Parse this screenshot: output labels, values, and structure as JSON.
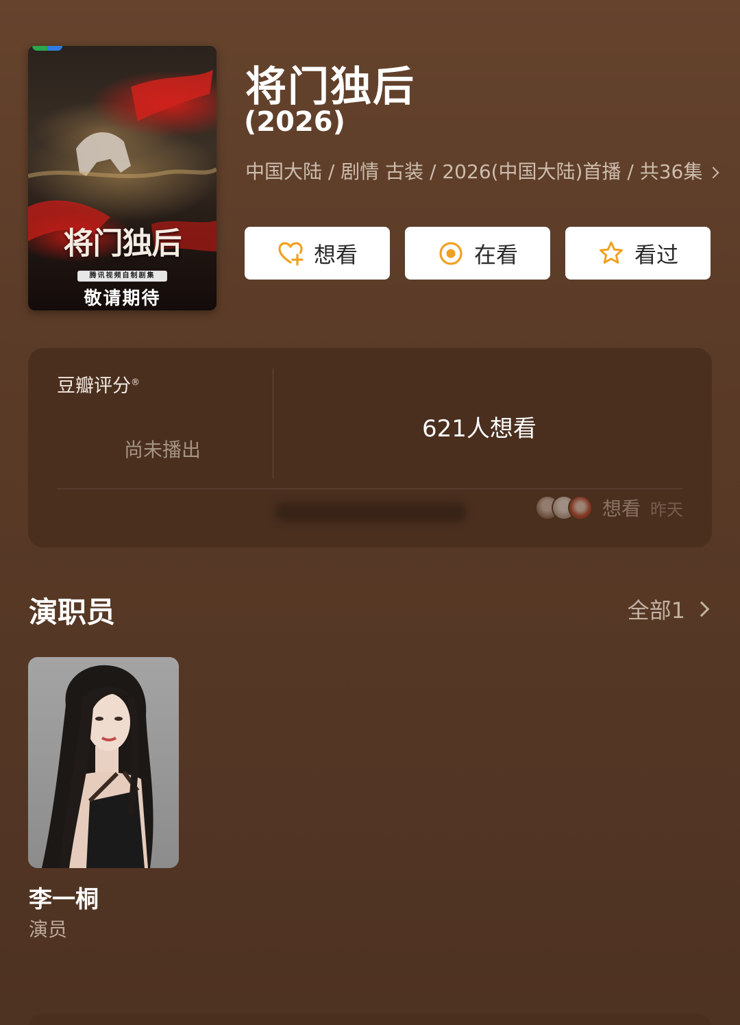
{
  "poster": {
    "title": "将门独后",
    "tag": "腾讯视频自制剧集",
    "subtitle": "敬请期待"
  },
  "show": {
    "title": "将门独后",
    "year": "(2026)",
    "meta": "中国大陆 / 剧情 古装 / 2026(中国大陆)首播 / 共36集"
  },
  "actions": [
    {
      "label": "想看",
      "icon": "heart-plus-icon"
    },
    {
      "label": "在看",
      "icon": "target-circle-icon"
    },
    {
      "label": "看过",
      "icon": "star-outline-icon"
    }
  ],
  "rating": {
    "label": "豆瓣评分",
    "mark": "®",
    "status": "尚未播出",
    "want_count": "621人想看",
    "activity_text": "想看",
    "activity_time": "昨天"
  },
  "cast": {
    "heading": "演职员",
    "all_label": "全部1",
    "members": [
      {
        "name": "李一桐",
        "role": "演员"
      }
    ]
  },
  "colors": {
    "background": "#5a3a26",
    "card": "#4a2f1f",
    "accent": "#f0a020"
  }
}
